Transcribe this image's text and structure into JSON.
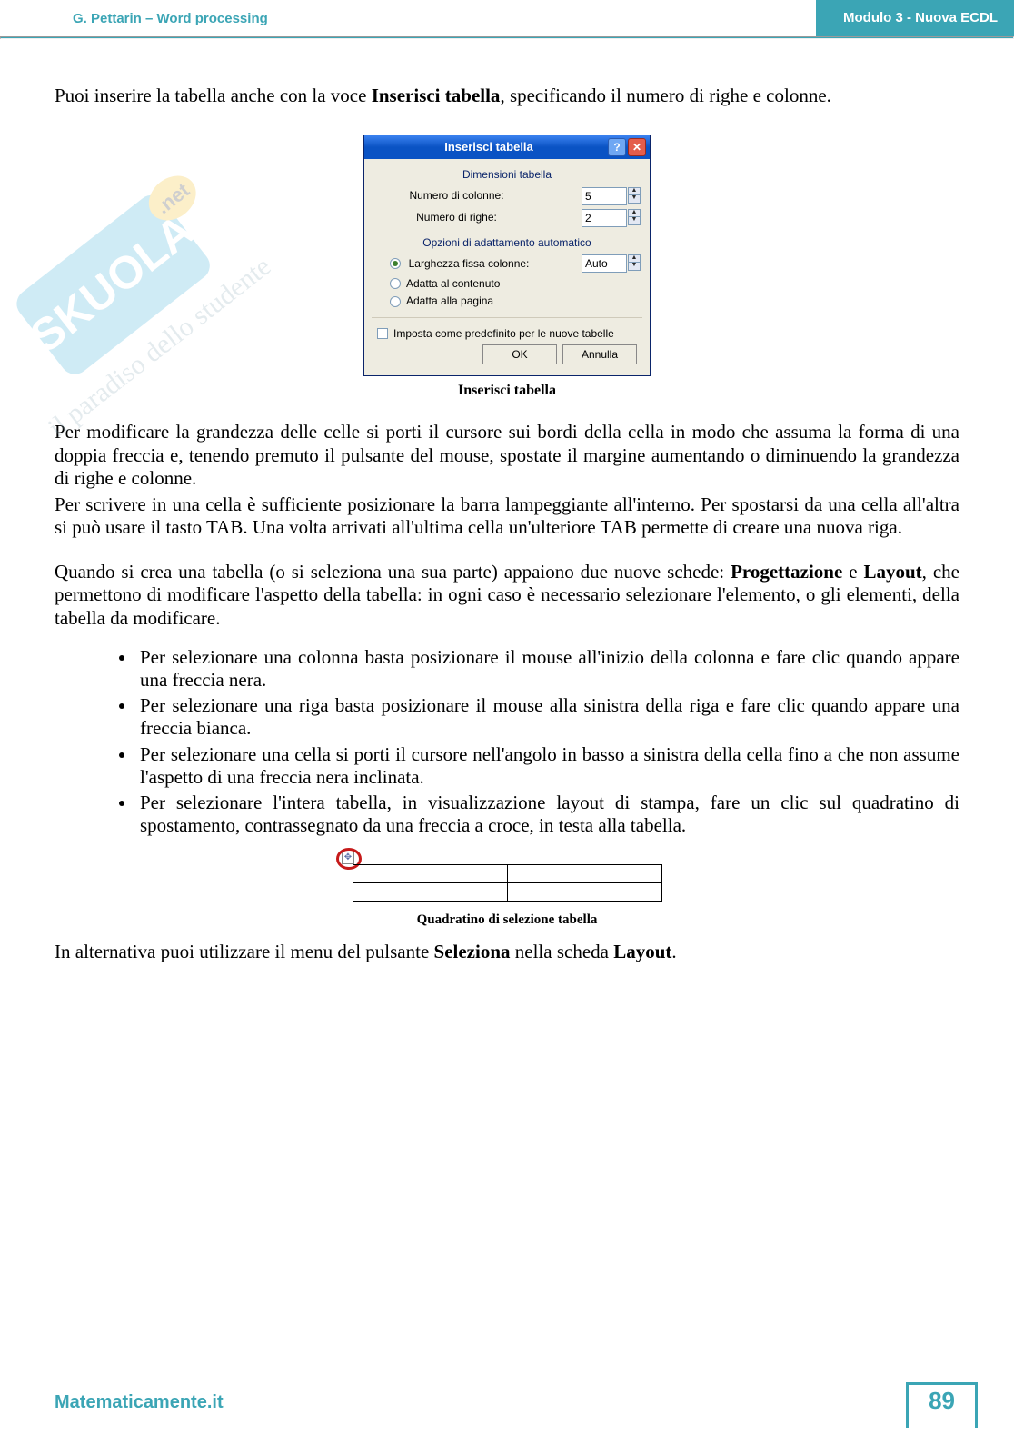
{
  "header": {
    "left": "G. Pettarin – Word processing",
    "right": "Modulo 3 - Nuova ECDL"
  },
  "intro": {
    "text_before": "Puoi inserire la tabella anche con la voce ",
    "bold": "Inserisci tabella",
    "text_after": ", specificando il numero di righe e colonne."
  },
  "dialog": {
    "title": "Inserisci tabella",
    "group_dim": "Dimensioni tabella",
    "cols_label": "Numero di colonne:",
    "cols_value": "5",
    "rows_label": "Numero di righe:",
    "rows_value": "2",
    "group_fit": "Opzioni di adattamento automatico",
    "opt_fixed": "Larghezza fissa colonne:",
    "opt_fixed_value": "Auto",
    "opt_content": "Adatta al contenuto",
    "opt_page": "Adatta alla pagina",
    "cb_default": "Imposta come predefinito per le nuove tabelle",
    "ok": "OK",
    "cancel": "Annulla",
    "caption": "Inserisci tabella"
  },
  "body1": "Per modificare la grandezza delle celle si porti il cursore sui bordi della cella in modo che assuma la forma di una doppia freccia e, tenendo premuto il pulsante del mouse, spostate il margine aumentando o diminuendo la grandezza di righe e colonne.",
  "body2": "Per scrivere in una cella è sufficiente posizionare la barra lampeggiante all'interno. Per spostarsi da una cella all'altra si può usare il tasto TAB. Una volta arrivati all'ultima cella un'ulteriore TAB permette di creare una nuova riga.",
  "body3": {
    "t1": "Quando si crea una tabella (o si seleziona una sua parte) appaiono due nuove schede: ",
    "b1": "Progettazione",
    "t2": " e ",
    "b2": "Layout",
    "t3": ", che permettono di modificare l'aspetto della tabella: in ogni caso è necessario selezionare l'elemento, o gli elementi, della tabella da modificare."
  },
  "bullets": [
    "Per selezionare una colonna basta posizionare il mouse all'inizio della colonna e fare clic quando appare una freccia nera.",
    "Per selezionare una riga basta posizionare il mouse alla sinistra  della riga e fare clic quando appare una freccia bianca.",
    "Per selezionare una cella si porti il cursore nell'angolo in basso a sinistra della cella fino a che non assume l'aspetto di una freccia nera inclinata.",
    "Per selezionare l'intera tabella, in visualizzazione layout di stampa, fare un clic sul quadratino di spostamento, contrassegnato da una freccia a croce, in testa alla tabella."
  ],
  "table_fig_caption": "Quadratino di selezione tabella",
  "closing": {
    "t1": "In alternativa puoi utilizzare il menu del pulsante ",
    "b1": "Seleziona",
    "t2": " nella scheda ",
    "b2": "Layout",
    "t3": "."
  },
  "footer": {
    "site": "Matematicamente.it",
    "page": "89"
  },
  "handle_glyph": "✥"
}
